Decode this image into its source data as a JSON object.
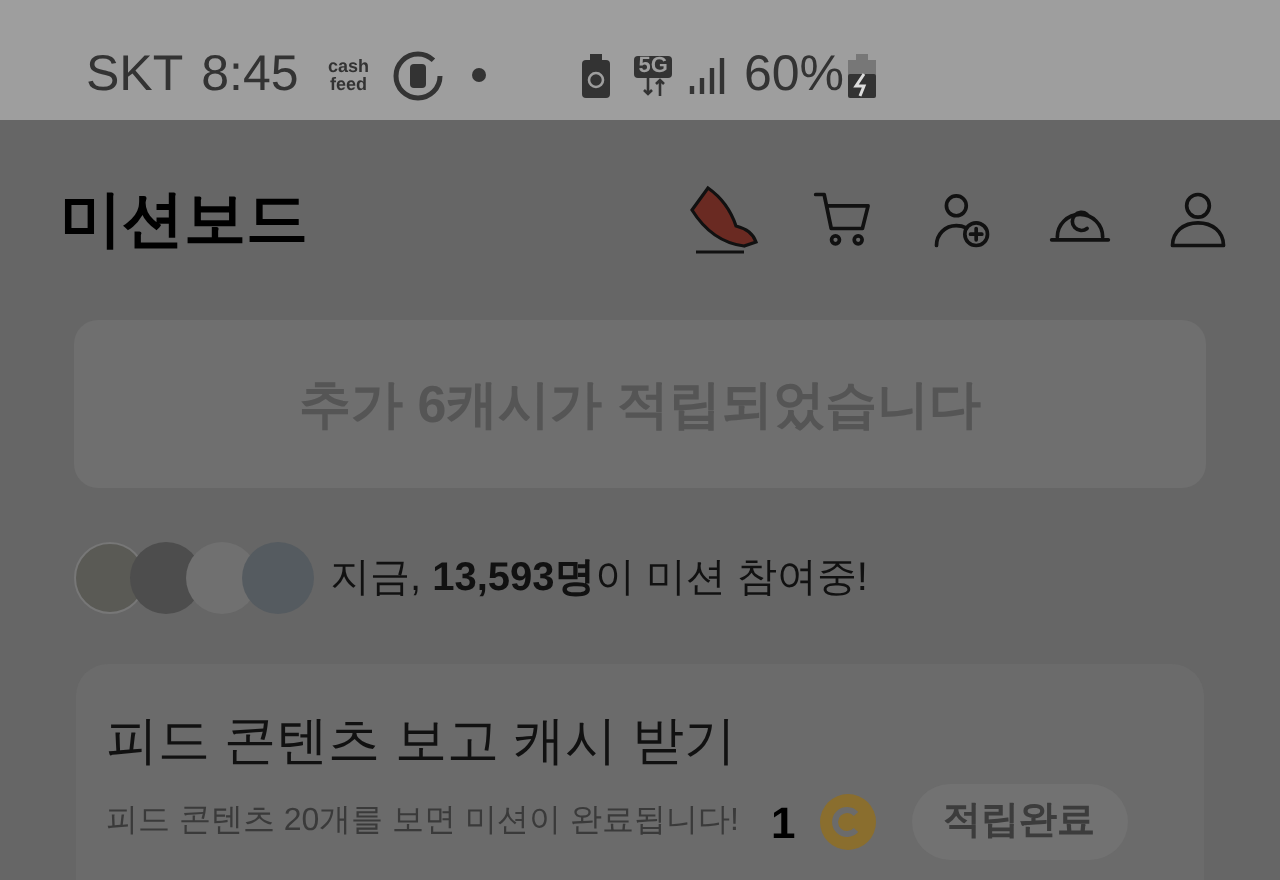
{
  "status_bar": {
    "carrier": "SKT",
    "time": "8:45",
    "app_badge": "cash feed",
    "battery": "60%",
    "network": "5G"
  },
  "header": {
    "title": "미션보드"
  },
  "banner": {
    "text": "추가 6캐시가 적립되었습니다"
  },
  "participants": {
    "text": "지금, **13,593명**이 미션 참여중!"
  },
  "mission": {
    "title": "피드 콘텐츠 보고 캐시 받기",
    "description": "피드 콘텐츠 20개를 보면 미션이 완료됩니다!",
    "reward": "1",
    "button": "적립완료"
  }
}
